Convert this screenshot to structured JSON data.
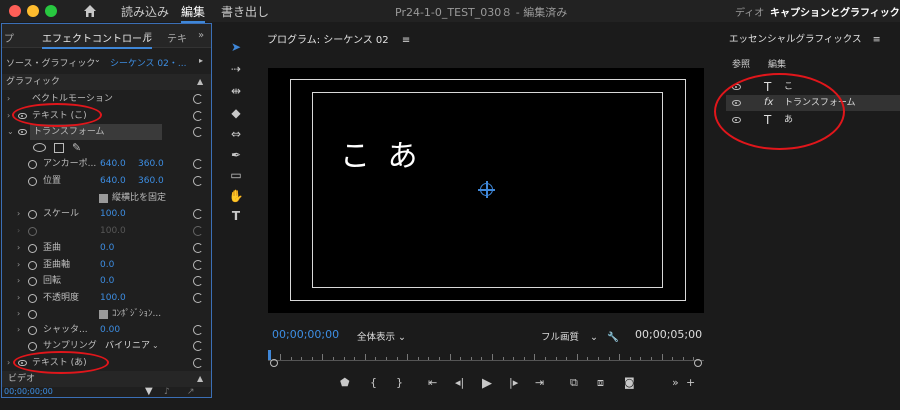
{
  "titlebar": {
    "workspaces": [
      "読み込み",
      "編集",
      "書き出し"
    ],
    "doc_title": "Pr24-1-0_TEST_030８ - 編集済み",
    "right1": "ディオ",
    "right2": "キャプションとグラフィック"
  },
  "left_panel": {
    "tab_prev": "プ",
    "tab_effect": "エフェクトコントロール",
    "tab_menu": "≡",
    "tab_next": "テキ",
    "source": "ソース・グラフィック",
    "sequence": "シーケンス 02・...",
    "section_graphic": "グラフィック",
    "vector_motion": "ベクトルモーション",
    "text_ko": "テキスト (こ)",
    "transform": "トランスフォーム",
    "anchor": {
      "label": "アンカーポ...",
      "x": "640.0",
      "y": "360.0"
    },
    "position": {
      "label": "位置",
      "x": "640.0",
      "y": "360.0"
    },
    "keep_ratio": "縦横比を固定",
    "scale": {
      "label": "スケール",
      "value": "100.0"
    },
    "scale2": {
      "value": "100.0"
    },
    "skew": {
      "label": "歪曲",
      "value": "0.0"
    },
    "skew_axis": {
      "label": "歪曲軸",
      "value": "0.0"
    },
    "rotation": {
      "label": "回転",
      "value": "0.0"
    },
    "opacity": {
      "label": "不透明度",
      "value": "100.0"
    },
    "composition": "ｺﾝﾎﾟｼﾞｼｮﾝ...",
    "shutter": {
      "label": "シャッタ...",
      "value": "0.00"
    },
    "sampling": {
      "label": "サンプリング",
      "value": "バイリニア"
    },
    "text_a": "テキスト (あ)",
    "section_video": "ビデオ",
    "timecode": "00;00;00;00"
  },
  "monitor": {
    "tab": "プログラム: シーケンス 02",
    "menu": "≡",
    "screen_text": "こ あ",
    "tc_left": "00;00;00;00",
    "fit": "全体表示",
    "quality": "フル画質",
    "tc_right": "00;00;05;00"
  },
  "right_panel": {
    "title": "エッセンシャルグラフィックス",
    "menu": "≡",
    "tab_browse": "参照",
    "tab_edit": "編集",
    "layers": [
      {
        "icon": "T",
        "name": "こ"
      },
      {
        "icon": "fx",
        "name": "トランスフォーム"
      },
      {
        "icon": "T",
        "name": "あ"
      }
    ]
  },
  "colors": {
    "accent": "#3f87d8",
    "annotation": "#e0161b",
    "timecode": "#3d8ee3"
  }
}
